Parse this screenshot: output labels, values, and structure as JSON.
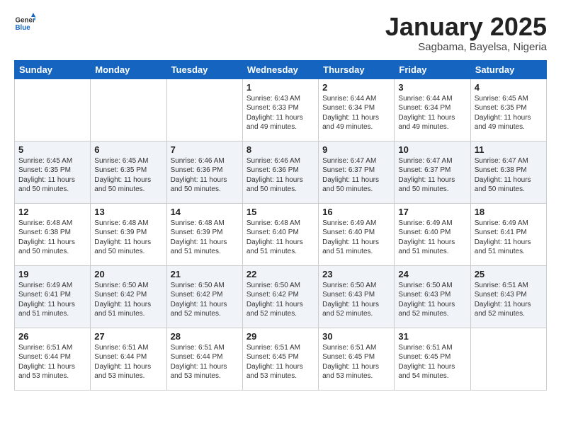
{
  "header": {
    "logo_general": "General",
    "logo_blue": "Blue",
    "month": "January 2025",
    "location": "Sagbama, Bayelsa, Nigeria"
  },
  "days_of_week": [
    "Sunday",
    "Monday",
    "Tuesday",
    "Wednesday",
    "Thursday",
    "Friday",
    "Saturday"
  ],
  "weeks": [
    [
      {
        "day": "",
        "content": ""
      },
      {
        "day": "",
        "content": ""
      },
      {
        "day": "",
        "content": ""
      },
      {
        "day": "1",
        "content": "Sunrise: 6:43 AM\nSunset: 6:33 PM\nDaylight: 11 hours and 49 minutes."
      },
      {
        "day": "2",
        "content": "Sunrise: 6:44 AM\nSunset: 6:34 PM\nDaylight: 11 hours and 49 minutes."
      },
      {
        "day": "3",
        "content": "Sunrise: 6:44 AM\nSunset: 6:34 PM\nDaylight: 11 hours and 49 minutes."
      },
      {
        "day": "4",
        "content": "Sunrise: 6:45 AM\nSunset: 6:35 PM\nDaylight: 11 hours and 49 minutes."
      }
    ],
    [
      {
        "day": "5",
        "content": "Sunrise: 6:45 AM\nSunset: 6:35 PM\nDaylight: 11 hours and 50 minutes."
      },
      {
        "day": "6",
        "content": "Sunrise: 6:45 AM\nSunset: 6:35 PM\nDaylight: 11 hours and 50 minutes."
      },
      {
        "day": "7",
        "content": "Sunrise: 6:46 AM\nSunset: 6:36 PM\nDaylight: 11 hours and 50 minutes."
      },
      {
        "day": "8",
        "content": "Sunrise: 6:46 AM\nSunset: 6:36 PM\nDaylight: 11 hours and 50 minutes."
      },
      {
        "day": "9",
        "content": "Sunrise: 6:47 AM\nSunset: 6:37 PM\nDaylight: 11 hours and 50 minutes."
      },
      {
        "day": "10",
        "content": "Sunrise: 6:47 AM\nSunset: 6:37 PM\nDaylight: 11 hours and 50 minutes."
      },
      {
        "day": "11",
        "content": "Sunrise: 6:47 AM\nSunset: 6:38 PM\nDaylight: 11 hours and 50 minutes."
      }
    ],
    [
      {
        "day": "12",
        "content": "Sunrise: 6:48 AM\nSunset: 6:38 PM\nDaylight: 11 hours and 50 minutes."
      },
      {
        "day": "13",
        "content": "Sunrise: 6:48 AM\nSunset: 6:39 PM\nDaylight: 11 hours and 50 minutes."
      },
      {
        "day": "14",
        "content": "Sunrise: 6:48 AM\nSunset: 6:39 PM\nDaylight: 11 hours and 51 minutes."
      },
      {
        "day": "15",
        "content": "Sunrise: 6:48 AM\nSunset: 6:40 PM\nDaylight: 11 hours and 51 minutes."
      },
      {
        "day": "16",
        "content": "Sunrise: 6:49 AM\nSunset: 6:40 PM\nDaylight: 11 hours and 51 minutes."
      },
      {
        "day": "17",
        "content": "Sunrise: 6:49 AM\nSunset: 6:40 PM\nDaylight: 11 hours and 51 minutes."
      },
      {
        "day": "18",
        "content": "Sunrise: 6:49 AM\nSunset: 6:41 PM\nDaylight: 11 hours and 51 minutes."
      }
    ],
    [
      {
        "day": "19",
        "content": "Sunrise: 6:49 AM\nSunset: 6:41 PM\nDaylight: 11 hours and 51 minutes."
      },
      {
        "day": "20",
        "content": "Sunrise: 6:50 AM\nSunset: 6:42 PM\nDaylight: 11 hours and 51 minutes."
      },
      {
        "day": "21",
        "content": "Sunrise: 6:50 AM\nSunset: 6:42 PM\nDaylight: 11 hours and 52 minutes."
      },
      {
        "day": "22",
        "content": "Sunrise: 6:50 AM\nSunset: 6:42 PM\nDaylight: 11 hours and 52 minutes."
      },
      {
        "day": "23",
        "content": "Sunrise: 6:50 AM\nSunset: 6:43 PM\nDaylight: 11 hours and 52 minutes."
      },
      {
        "day": "24",
        "content": "Sunrise: 6:50 AM\nSunset: 6:43 PM\nDaylight: 11 hours and 52 minutes."
      },
      {
        "day": "25",
        "content": "Sunrise: 6:51 AM\nSunset: 6:43 PM\nDaylight: 11 hours and 52 minutes."
      }
    ],
    [
      {
        "day": "26",
        "content": "Sunrise: 6:51 AM\nSunset: 6:44 PM\nDaylight: 11 hours and 53 minutes."
      },
      {
        "day": "27",
        "content": "Sunrise: 6:51 AM\nSunset: 6:44 PM\nDaylight: 11 hours and 53 minutes."
      },
      {
        "day": "28",
        "content": "Sunrise: 6:51 AM\nSunset: 6:44 PM\nDaylight: 11 hours and 53 minutes."
      },
      {
        "day": "29",
        "content": "Sunrise: 6:51 AM\nSunset: 6:45 PM\nDaylight: 11 hours and 53 minutes."
      },
      {
        "day": "30",
        "content": "Sunrise: 6:51 AM\nSunset: 6:45 PM\nDaylight: 11 hours and 53 minutes."
      },
      {
        "day": "31",
        "content": "Sunrise: 6:51 AM\nSunset: 6:45 PM\nDaylight: 11 hours and 54 minutes."
      },
      {
        "day": "",
        "content": ""
      }
    ]
  ]
}
